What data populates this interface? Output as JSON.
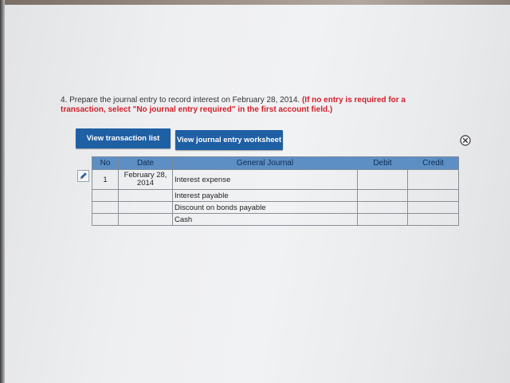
{
  "question": {
    "number": "4.",
    "text": "Prepare the journal entry to record interest on February 28, 2014.",
    "instruction": "(If no entry is required for a transaction, select \"No journal entry required\" in the first account field.)"
  },
  "buttons": {
    "view_transaction_list": "View transaction list",
    "view_journal_entry_worksheet": "View journal entry worksheet"
  },
  "icons": {
    "close": "close-circle-icon",
    "edit": "pencil-icon"
  },
  "colors": {
    "button_bg": "#1f5fa4",
    "header_bg": "#5d8fc4",
    "instruction_red": "#d0202a"
  },
  "table": {
    "headers": {
      "no": "No",
      "date": "Date",
      "general_journal": "General Journal",
      "debit": "Debit",
      "credit": "Credit"
    },
    "rows": [
      {
        "no": "1",
        "date": "February 28, 2014",
        "account": "Interest expense",
        "debit": "",
        "credit": ""
      },
      {
        "no": "",
        "date": "",
        "account": "Interest payable",
        "debit": "",
        "credit": ""
      },
      {
        "no": "",
        "date": "",
        "account": "Discount on bonds payable",
        "debit": "",
        "credit": ""
      },
      {
        "no": "",
        "date": "",
        "account": "Cash",
        "debit": "",
        "credit": ""
      }
    ]
  }
}
